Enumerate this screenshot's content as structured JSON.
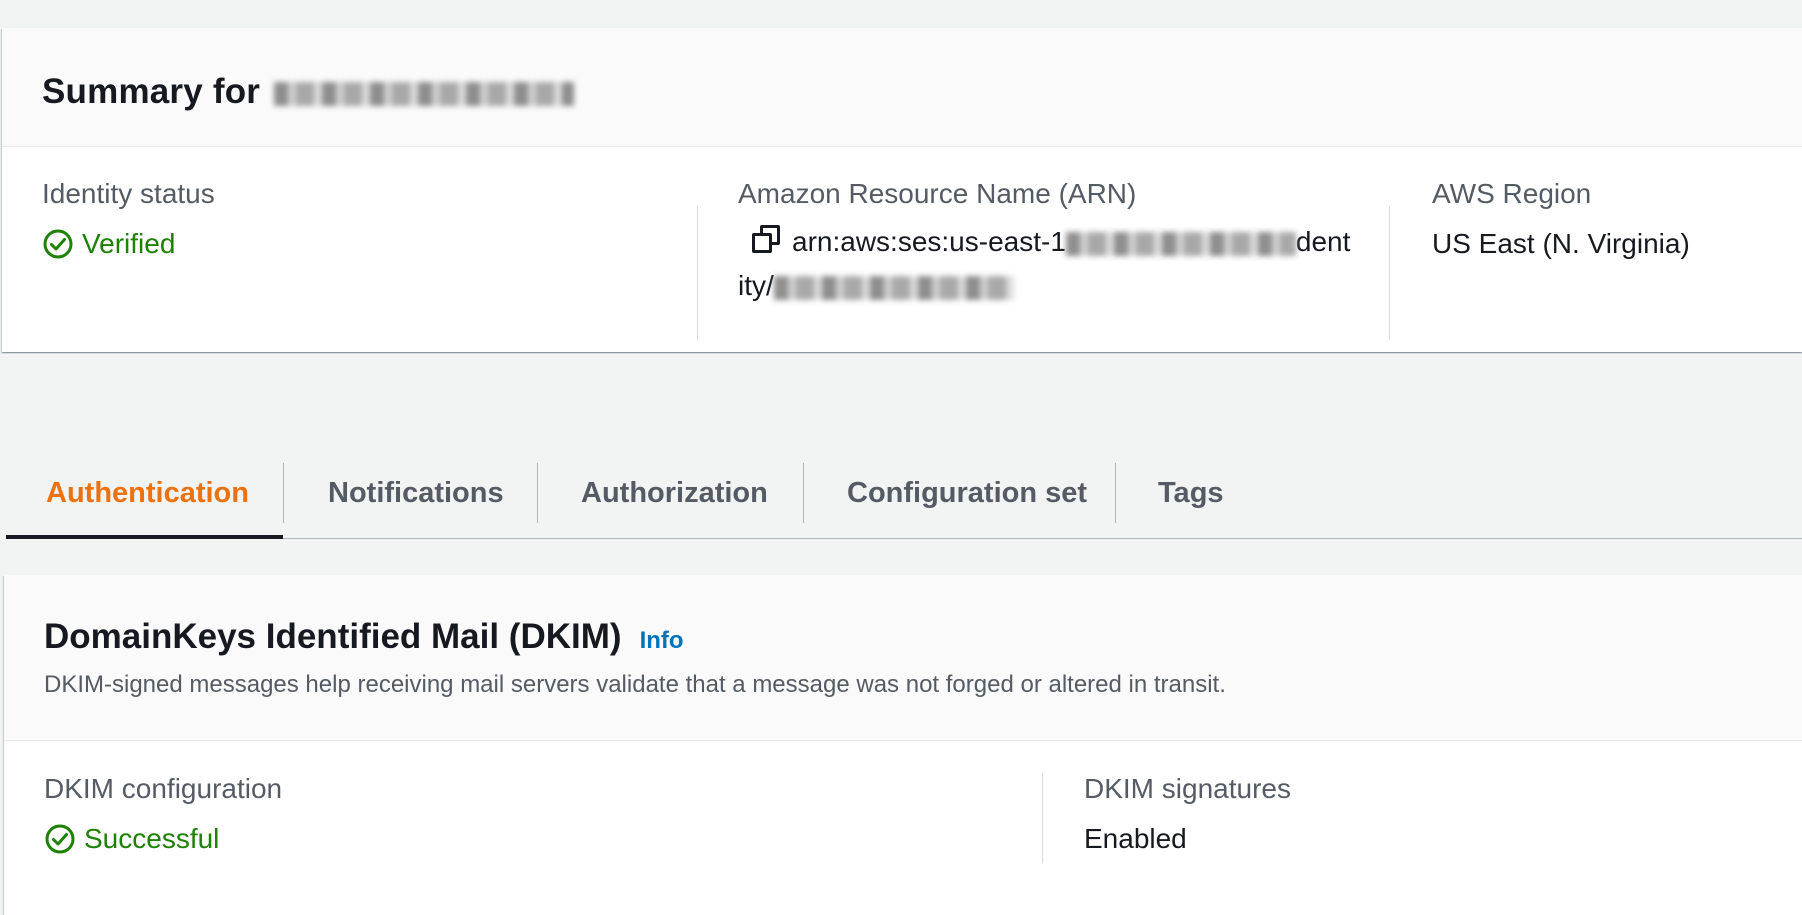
{
  "summary": {
    "title_prefix": "Summary for",
    "identity_status": {
      "label": "Identity status",
      "value": "Verified"
    },
    "arn": {
      "label": "Amazon Resource Name (ARN)",
      "value_start": "arn:aws:ses:us-east-1",
      "value_mid": "dent",
      "value_line2_start": "ity/"
    },
    "region": {
      "label": "AWS Region",
      "value": "US East (N. Virginia)"
    }
  },
  "tabs": [
    {
      "label": "Authentication",
      "active": true
    },
    {
      "label": "Notifications",
      "active": false
    },
    {
      "label": "Authorization",
      "active": false
    },
    {
      "label": "Configuration set",
      "active": false
    },
    {
      "label": "Tags",
      "active": false
    }
  ],
  "dkim": {
    "title": "DomainKeys Identified Mail (DKIM)",
    "info_link": "Info",
    "description": "DKIM-signed messages help receiving mail servers validate that a message was not forged or altered in transit.",
    "configuration": {
      "label": "DKIM configuration",
      "value": "Successful"
    },
    "signatures": {
      "label": "DKIM signatures",
      "value": "Enabled"
    }
  },
  "colors": {
    "accent_orange": "#ec7211",
    "success_green": "#1d8102",
    "link_blue": "#0073bb"
  },
  "icons": [
    "status-success-icon",
    "copy-icon"
  ]
}
